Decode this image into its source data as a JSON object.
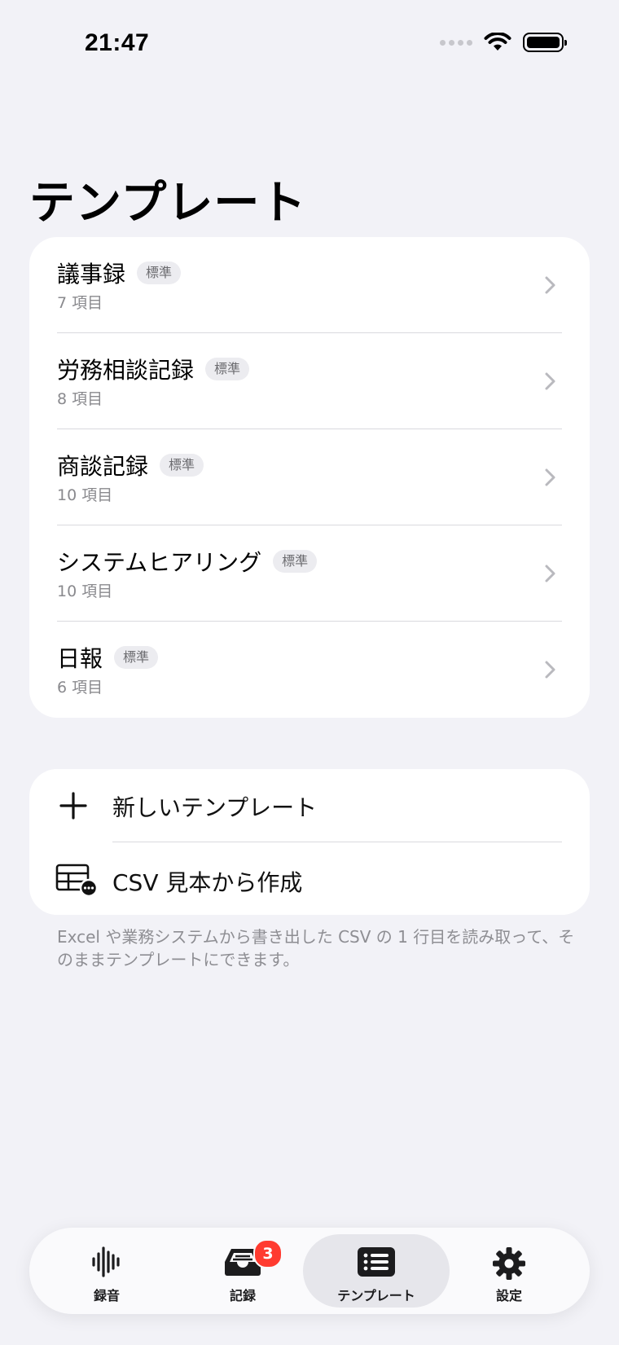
{
  "status_bar": {
    "time": "21:47"
  },
  "page": {
    "title": "テンプレート"
  },
  "templates": [
    {
      "name": "議事録",
      "badge": "標準",
      "count": "7 項目"
    },
    {
      "name": "労務相談記録",
      "badge": "標準",
      "count": "8 項目"
    },
    {
      "name": "商談記録",
      "badge": "標準",
      "count": "10 項目"
    },
    {
      "name": "システムヒアリング",
      "badge": "標準",
      "count": "10 項目"
    },
    {
      "name": "日報",
      "badge": "標準",
      "count": "6 項目"
    }
  ],
  "actions": {
    "new_template": "新しいテンプレート",
    "csv_create": "CSV 見本から作成",
    "new_template_icon": "plus-icon",
    "csv_icon": "table-more-icon"
  },
  "footnote": "Excel や業務システムから書き出した CSV の 1 行目を読み取って、そのままテンプレートにできます。",
  "tab_bar": {
    "tabs": [
      {
        "label": "録音",
        "icon": "waveform-icon"
      },
      {
        "label": "記録",
        "icon": "tray-icon",
        "badge": "3"
      },
      {
        "label": "テンプレート",
        "icon": "list-icon",
        "active": true
      },
      {
        "label": "設定",
        "icon": "gear-icon"
      }
    ]
  },
  "colors": {
    "background": "#f2f2f7",
    "card": "#ffffff",
    "badge_red": "#ff3b30",
    "secondary_text": "#8e8e93"
  }
}
